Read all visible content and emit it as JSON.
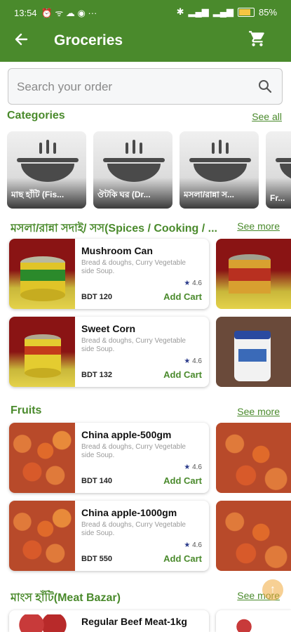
{
  "status_bar": {
    "time": "13:54",
    "left_icons": "⏰ ᯤ ☁ ◉ ···",
    "battery": "85",
    "percent_sign": "%"
  },
  "app_bar": {
    "title": "Groceries"
  },
  "search": {
    "placeholder": "Search your order",
    "value": ""
  },
  "categories": {
    "title": "Categories",
    "see_all": "See all",
    "items": [
      {
        "label": "মাছ হাঁটি (Fis..."
      },
      {
        "label": "ঔটকি ঘর (Dr..."
      },
      {
        "label": "মসলা/রান্না স..."
      },
      {
        "label": "Fr..."
      }
    ]
  },
  "sections": [
    {
      "title": "মসলা/রান্না সদাই/ সস(Spices / Cooking / ...",
      "see_more": "See more",
      "products": [
        {
          "name": "Mushroom Can",
          "desc": "Bread & doughs, Curry Vegetable side Soup.",
          "rating": "4.6",
          "price": "BDT 120",
          "add": "Add Cart"
        },
        {
          "name": "Sweet Corn",
          "desc": "Bread & doughs, Curry Vegetable side Soup.",
          "rating": "4.6",
          "price": "BDT 132",
          "add": "Add Cart"
        }
      ]
    },
    {
      "title": "Fruits",
      "see_more": "See more",
      "products": [
        {
          "name": "China apple-500gm",
          "desc": "Bread & doughs, Curry Vegetable side Soup.",
          "rating": "4.6",
          "price": "BDT 140",
          "add": "Add Cart"
        },
        {
          "name": "China apple-1000gm",
          "desc": "Bread & doughs, Curry Vegetable side Soup.",
          "rating": "4.6",
          "price": "BDT 550",
          "add": "Add Cart"
        }
      ]
    },
    {
      "title": "মাংস হাঁটি(Meat Bazar)",
      "see_more": "See more",
      "products": [
        {
          "name": "Regular Beef Meat-1kg"
        }
      ]
    }
  ],
  "colors": {
    "primary": "#4a8a2c",
    "star": "#2a3a8a"
  },
  "icons": {
    "back": "arrow-left-icon",
    "cart": "shopping-cart-icon",
    "search": "search-icon",
    "category": "cooking-pot-icon"
  }
}
